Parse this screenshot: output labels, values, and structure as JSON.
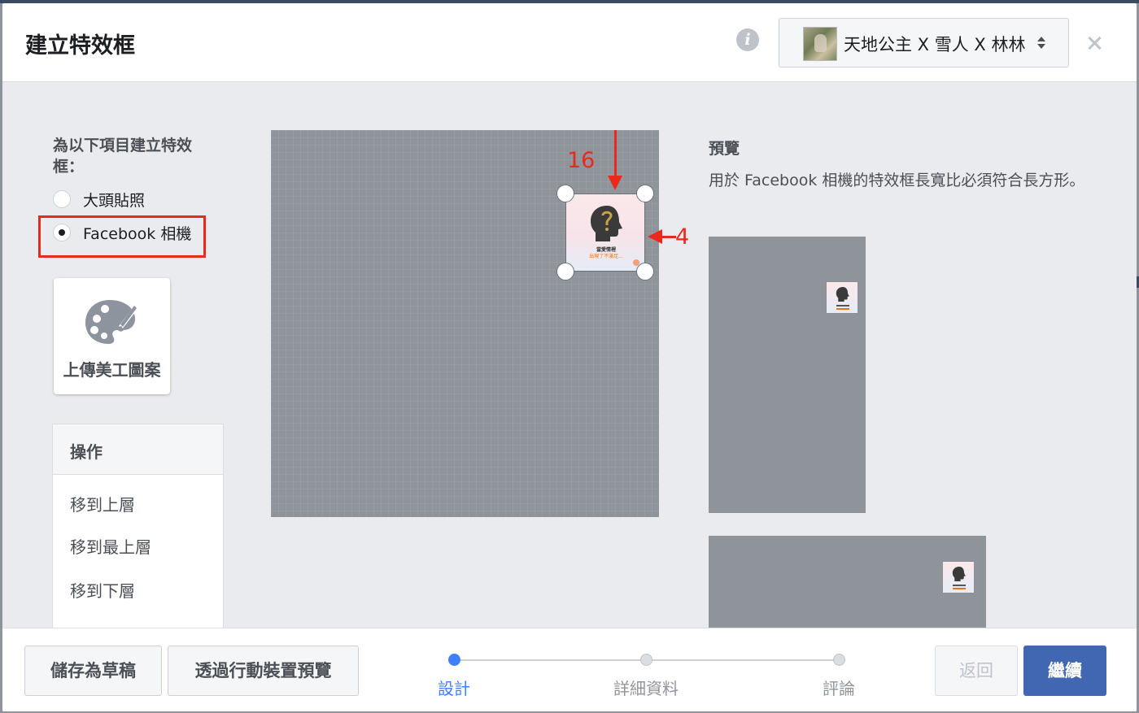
{
  "dialog": {
    "title": "建立特效框",
    "info_icon_glyph": "i",
    "page_selector": {
      "label": "天地公主 X 雪人 X 林林",
      "icon": "page-avatar"
    }
  },
  "left": {
    "frame_for_label": "為以下項目建立特效框：",
    "options": [
      {
        "label": "大頭貼照",
        "checked": false
      },
      {
        "label": "Facebook 相機",
        "checked": true
      }
    ],
    "upload_label": "上傳美工圖案",
    "operations": {
      "header": "操作",
      "items": [
        "移到上層",
        "移到最上層",
        "移到下層"
      ]
    }
  },
  "canvas": {
    "sticker_text_1": "當愛情裡",
    "sticker_text_2": "出現了不滿足...",
    "annotation_top": "16",
    "annotation_right": "4"
  },
  "preview": {
    "title": "預覽",
    "description": "用於 Facebook 相機的特效框長寬比必須符合長方形。"
  },
  "footer": {
    "save_draft": "儲存為草稿",
    "mobile_preview": "透過行動裝置預覽",
    "steps": [
      {
        "label": "設計",
        "active": true
      },
      {
        "label": "詳細資料",
        "active": false
      },
      {
        "label": "評論",
        "active": false
      }
    ],
    "back": "返回",
    "continue": "繼續"
  },
  "colors": {
    "primary": "#4267b2",
    "step_active": "#4080ff",
    "annotation": "#e8291c",
    "canvas": "#8f939a"
  }
}
